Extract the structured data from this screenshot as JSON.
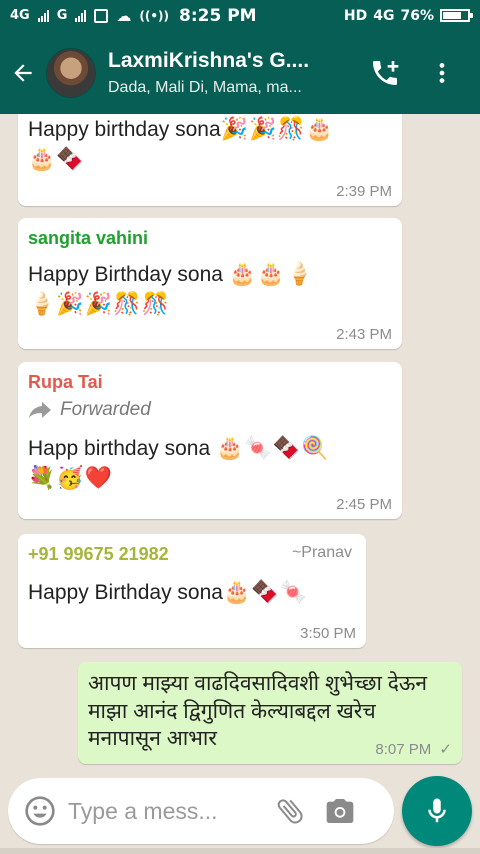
{
  "status_bar": {
    "net1": "4G",
    "net2": "G",
    "time": "8:25 PM",
    "hd": "HD",
    "net3": "4G",
    "battery_text": "76%",
    "battery_level": 0.76
  },
  "header": {
    "title": "LaxmiKrishna's G....",
    "subtitle": "Dada, Mali Di, Mama, ma...",
    "icons": {
      "back": "arrow-back-icon",
      "call": "add-call-icon",
      "menu": "more-vert-icon"
    }
  },
  "messages": [
    {
      "sender": "",
      "text": "Happy birthday sona",
      "emoji_line1": "🎉🎉🎊🎂",
      "emoji_line2": "🎂🍫",
      "time": "2:39 PM"
    },
    {
      "sender": "sangita vahini",
      "sender_color": "#1fa12e",
      "text": "Happy Birthday sona",
      "emoji_line1": "🎂🎂🍦",
      "emoji_line2": "🍦🎉🎉🎊🎊",
      "time": "2:43 PM"
    },
    {
      "sender": "Rupa Tai",
      "sender_color": "#e05a4e",
      "forwarded_label": "Forwarded",
      "text": "Happ birthday sona",
      "emoji_line1": "🎂🍬🍫🍭",
      "emoji_line2": "💐🥳❤️",
      "time": "2:45 PM"
    },
    {
      "sender": "+91 99675 21982",
      "sender_color": "#a6b53b",
      "author": "~Pranav",
      "text": "Happy Birthday sona",
      "emoji_line1": "🎂🍫🍬",
      "time": "3:50 PM"
    },
    {
      "text": "आपण माझ्या वाढदिवसादिवशी शुभेच्छा देऊन माझा आनंद द्विगुणित केल्याबद्दल खरेच मनापासून आभार",
      "time": "8:07 PM",
      "status": "✓"
    }
  ],
  "composer": {
    "placeholder": "Type a mess...",
    "icons": {
      "emoji": "emoji-icon",
      "attach": "attachment-icon",
      "camera": "camera-icon",
      "mic": "mic-icon"
    }
  },
  "colors": {
    "header": "#075e54",
    "incoming_bubble": "#ffffff",
    "outgoing_bubble": "#dcf8c6",
    "fab": "#00897b"
  }
}
